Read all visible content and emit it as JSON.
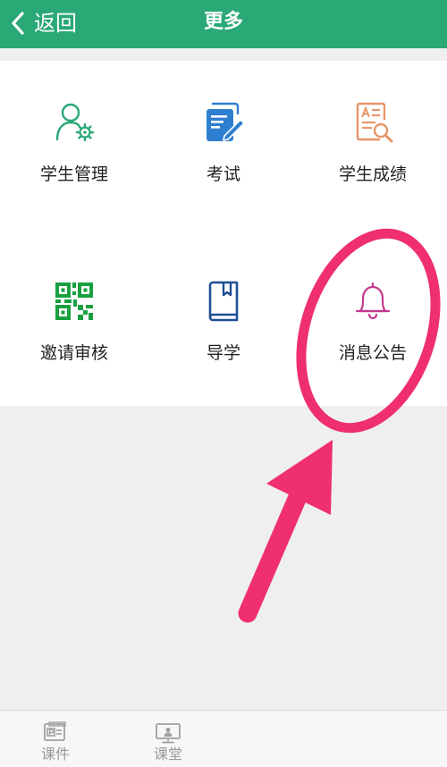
{
  "header": {
    "back_label": "返回",
    "title": "更多",
    "background": "#2aa876"
  },
  "grid": {
    "items": [
      {
        "label": "学生管理",
        "icon": "user-gear-icon",
        "color": "#2aa876"
      },
      {
        "label": "考试",
        "icon": "exam-paper-icon",
        "color": "#2f7fd0"
      },
      {
        "label": "学生成绩",
        "icon": "report-search-icon",
        "color": "#e8966a"
      },
      {
        "label": "邀请审核",
        "icon": "qr-code-icon",
        "color": "#18a040"
      },
      {
        "label": "导学",
        "icon": "book-icon",
        "color": "#1f4f96"
      },
      {
        "label": "消息公告",
        "icon": "bell-icon",
        "color": "#c0398e"
      }
    ]
  },
  "annotation": {
    "color": "#ef2f6f",
    "shapes": [
      "highlight-ellipse",
      "pointer-arrow"
    ]
  },
  "tabbar": {
    "items": [
      {
        "label": "课件",
        "icon": "courseware-icon"
      },
      {
        "label": "课堂",
        "icon": "classroom-icon"
      }
    ]
  }
}
